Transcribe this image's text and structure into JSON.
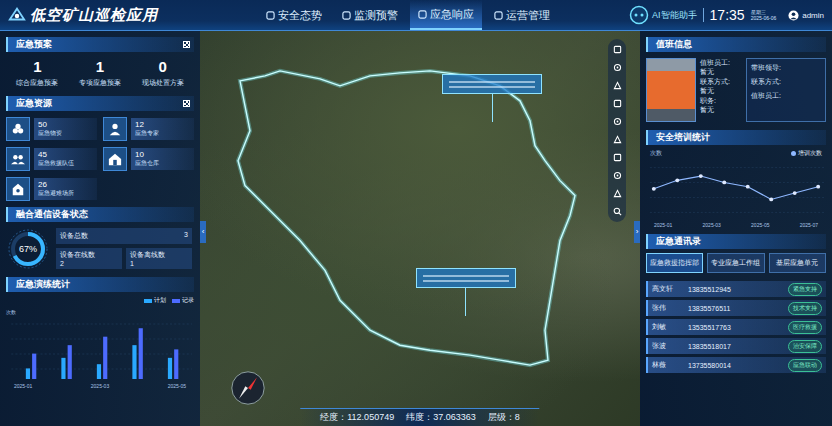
{
  "header": {
    "title": "低空矿山巡检应用",
    "nav": [
      {
        "label": "安全态势",
        "selected": false
      },
      {
        "label": "监测预警",
        "selected": false
      },
      {
        "label": "应急响应",
        "selected": true
      },
      {
        "label": "运营管理",
        "selected": false
      }
    ],
    "assistant": "AI智能助手",
    "time": "17:35",
    "weekday": "星期三",
    "date": "2025-06-06",
    "user": "admin"
  },
  "left": {
    "plans": {
      "title": "应急预案",
      "items": [
        {
          "value": "1",
          "label": "综合应急预案"
        },
        {
          "value": "1",
          "label": "专项应急预案"
        },
        {
          "value": "0",
          "label": "现场处置方案"
        }
      ]
    },
    "resources": {
      "title": "应急资源",
      "items": [
        {
          "value": "50",
          "label": "应急物资"
        },
        {
          "value": "12",
          "label": "应急专家"
        },
        {
          "value": "45",
          "label": "应急救援队伍"
        },
        {
          "value": "10",
          "label": "应急仓库"
        },
        {
          "value": "26",
          "label": "应急避难场所"
        }
      ]
    },
    "comms": {
      "title": "融合通信设备状态",
      "level": 0.67,
      "percent": "67%",
      "total_label": "设备总数",
      "total": "3",
      "online_label": "设备在线数",
      "online": "2",
      "offline_label": "设备离线数",
      "offline": "1"
    },
    "drills": {
      "title": "应急演练统计",
      "legend": [
        "计划",
        "记录"
      ],
      "y_label": "次数",
      "x_labels": [
        "2025-01",
        "2025-03",
        "2025-05"
      ],
      "plan": [
        5,
        10,
        7,
        16,
        10
      ],
      "record": [
        12,
        16,
        20,
        24,
        14
      ]
    }
  },
  "map": {
    "longitude_label": "经度：",
    "longitude": "112.050749",
    "latitude_label": "纬度：",
    "latitude": "37.063363",
    "zoom_label": "层级：",
    "zoom": "8"
  },
  "right": {
    "duty": {
      "title": "值班信息",
      "fields": [
        {
          "label": "值班员工:",
          "value": "暂无"
        },
        {
          "label": "联系方式:",
          "value": "暂无"
        },
        {
          "label": "职务:",
          "value": "暂无"
        }
      ],
      "leaders": [
        {
          "label": "带班领导:",
          "value": ""
        },
        {
          "label": "联系方式:",
          "value": ""
        },
        {
          "label": "值班员工:",
          "value": ""
        }
      ]
    },
    "training": {
      "title": "安全培训统计",
      "legend": "培训次数",
      "y_label": "次数",
      "x_labels": [
        "2025-01",
        "2025-03",
        "2025-05",
        "2025-07"
      ],
      "values": [
        12,
        16,
        18,
        15,
        13,
        7,
        10,
        13
      ]
    },
    "contacts": {
      "title": "应急通讯录",
      "tabs": [
        {
          "label": "应急救援指挥部",
          "selected": true
        },
        {
          "label": "专业应急工作组",
          "selected": false
        },
        {
          "label": "基层应急单元",
          "selected": false
        }
      ],
      "rows": [
        {
          "name": "高文轩",
          "phone": "13835512945",
          "tag": "紧急支持"
        },
        {
          "name": "张伟",
          "phone": "13835576511",
          "tag": "技术支持"
        },
        {
          "name": "刘敏",
          "phone": "13535517763",
          "tag": "医疗救援"
        },
        {
          "name": "张波",
          "phone": "13835518017",
          "tag": "治安保障"
        },
        {
          "name": "林薇",
          "phone": "13735580014",
          "tag": "应急联动"
        }
      ]
    }
  }
}
